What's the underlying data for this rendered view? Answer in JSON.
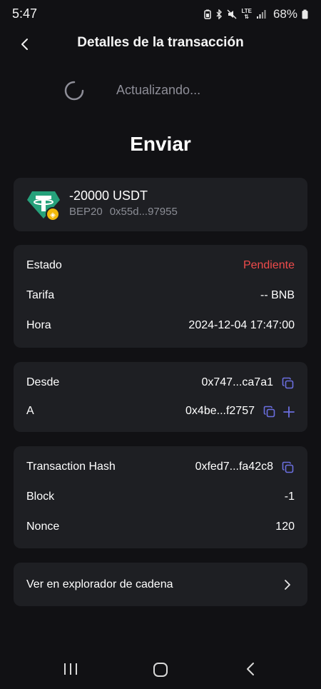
{
  "status_bar": {
    "time": "5:47",
    "battery": "68%",
    "network": "LTE"
  },
  "header": {
    "title": "Detalles de la transacción"
  },
  "updating": {
    "text": "Actualizando..."
  },
  "page_title": "Enviar",
  "token": {
    "amount": "-20000 USDT",
    "network": "BEP20",
    "address": "0x55d...97955",
    "icon": "tether-usdt-logo"
  },
  "details": {
    "status_label": "Estado",
    "status_value": "Pendiente",
    "fee_label": "Tarifa",
    "fee_value": "-- BNB",
    "time_label": "Hora",
    "time_value": "2024-12-04 17:47:00"
  },
  "addresses": {
    "from_label": "Desde",
    "from_value": "0x747...ca7a1",
    "to_label": "A",
    "to_value": "0x4be...f2757"
  },
  "chain": {
    "hash_label": "Transaction Hash",
    "hash_value": "0xfed7...fa42c8",
    "block_label": "Block",
    "block_value": "-1",
    "nonce_label": "Nonce",
    "nonce_value": "120"
  },
  "explorer": {
    "label": "Ver en explorador de cadena"
  },
  "colors": {
    "background": "#111114",
    "card": "#1e1f23",
    "pending": "#ef4b4b",
    "accent_icon": "#6b6fe0",
    "muted_text": "#8b8d95"
  }
}
